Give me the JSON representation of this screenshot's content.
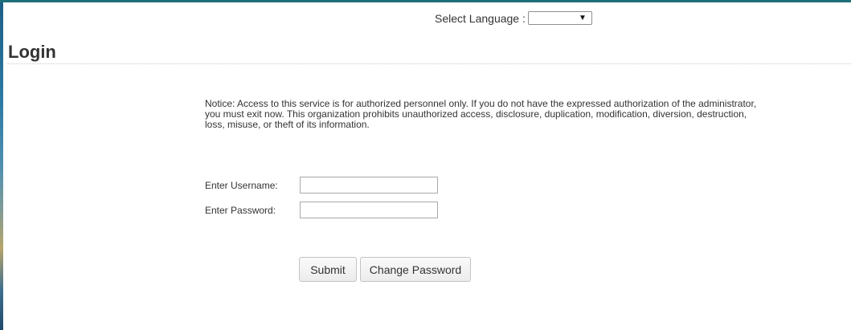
{
  "language": {
    "label": "Select Language :",
    "selected": ""
  },
  "page": {
    "title": "Login"
  },
  "notice": {
    "text": "Notice: Access to this service is for authorized personnel only. If you do not have the expressed authorization of the administrator, you must exit now. This organization prohibits unauthorized access, disclosure, duplication, modification, diversion, destruction, loss, misuse, or theft of its information."
  },
  "form": {
    "username_label": "Enter Username:",
    "username_value": "",
    "password_label": "Enter Password:",
    "password_value": ""
  },
  "buttons": {
    "submit_label": "Submit",
    "change_password_label": "Change Password"
  },
  "colors": {
    "top_border": "#1f6f78",
    "text": "#333333"
  }
}
